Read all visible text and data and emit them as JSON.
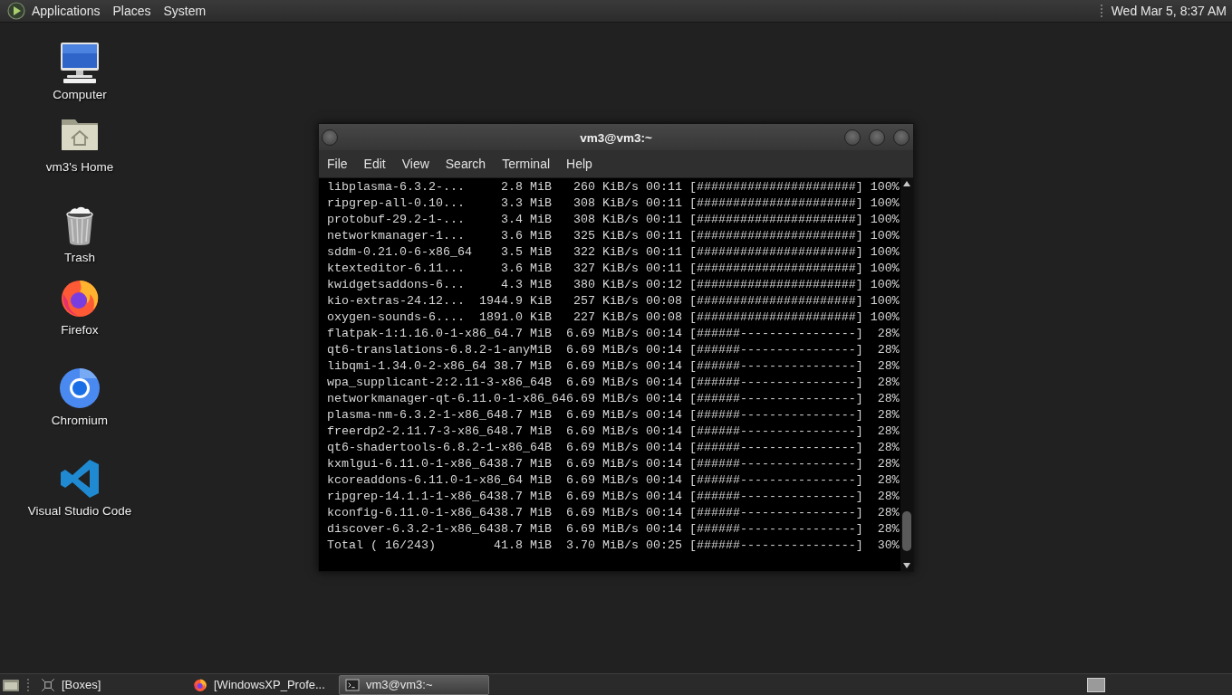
{
  "top_panel": {
    "menus": [
      "Applications",
      "Places",
      "System"
    ],
    "clock": "Wed Mar 5, 8:37 AM"
  },
  "desktop_icons": [
    {
      "label": "Computer",
      "kind": "computer"
    },
    {
      "label": "vm3's Home",
      "kind": "home"
    },
    {
      "label": "Trash",
      "kind": "trash"
    },
    {
      "label": "Firefox",
      "kind": "firefox"
    },
    {
      "label": "Chromium",
      "kind": "chromium"
    },
    {
      "label": "Visual Studio Code",
      "kind": "vscode"
    }
  ],
  "terminal": {
    "title": "vm3@vm3:~",
    "menu": [
      "File",
      "Edit",
      "View",
      "Search",
      "Terminal",
      "Help"
    ],
    "lines": [
      "libplasma-6.3.2-...     2.8 MiB   260 KiB/s 00:11 [######################] 100%",
      "ripgrep-all-0.10...     3.3 MiB   308 KiB/s 00:11 [######################] 100%",
      "protobuf-29.2-1-...     3.4 MiB   308 KiB/s 00:11 [######################] 100%",
      "networkmanager-1...     3.6 MiB   325 KiB/s 00:11 [######################] 100%",
      "sddm-0.21.0-6-x86_64    3.5 MiB   322 KiB/s 00:11 [######################] 100%",
      "ktexteditor-6.11...     3.6 MiB   327 KiB/s 00:11 [######################] 100%",
      "kwidgetsaddons-6...     4.3 MiB   380 KiB/s 00:12 [######################] 100%",
      "kio-extras-24.12...  1944.9 KiB   257 KiB/s 00:08 [######################] 100%",
      "oxygen-sounds-6....  1891.0 KiB   227 KiB/s 00:08 [######################] 100%",
      "flatpak-1:1.16.0-1-x86_64.7 MiB  6.69 MiB/s 00:14 [######----------------]  28%",
      "qt6-translations-6.8.2-1-anyMiB  6.69 MiB/s 00:14 [######----------------]  28%",
      "libqmi-1.34.0-2-x86_64 38.7 MiB  6.69 MiB/s 00:14 [######----------------]  28%",
      "wpa_supplicant-2:2.11-3-x86_64B  6.69 MiB/s 00:14 [######----------------]  28%",
      "networkmanager-qt-6.11.0-1-x86_646.69 MiB/s 00:14 [######----------------]  28%",
      "plasma-nm-6.3.2-1-x86_648.7 MiB  6.69 MiB/s 00:14 [######----------------]  28%",
      "freerdp2-2.11.7-3-x86_648.7 MiB  6.69 MiB/s 00:14 [######----------------]  28%",
      "qt6-shadertools-6.8.2-1-x86_64B  6.69 MiB/s 00:14 [######----------------]  28%",
      "kxmlgui-6.11.0-1-x86_6438.7 MiB  6.69 MiB/s 00:14 [######----------------]  28%",
      "kcoreaddons-6.11.0-1-x86_64 MiB  6.69 MiB/s 00:14 [######----------------]  28%",
      "ripgrep-14.1.1-1-x86_6438.7 MiB  6.69 MiB/s 00:14 [######----------------]  28%",
      "kconfig-6.11.0-1-x86_6438.7 MiB  6.69 MiB/s 00:14 [######----------------]  28%",
      "discover-6.3.2-1-x86_6438.7 MiB  6.69 MiB/s 00:14 [######----------------]  28%",
      "Total ( 16/243)        41.8 MiB  3.70 MiB/s 00:25 [######----------------]  30%"
    ]
  },
  "taskbar": {
    "items": [
      {
        "label": "[Boxes]",
        "kind": "boxes",
        "selected": false
      },
      {
        "label": "[WindowsXP_Profe...",
        "kind": "firefox",
        "selected": false
      },
      {
        "label": "vm3@vm3:~",
        "kind": "terminal",
        "selected": true
      }
    ]
  }
}
